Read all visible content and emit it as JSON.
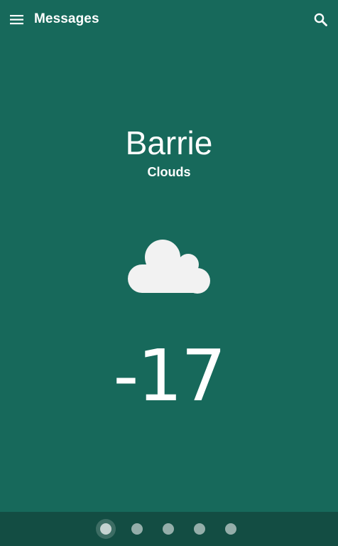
{
  "toolbar": {
    "title": "Messages",
    "menu_icon": "menu-icon",
    "search_icon": "search-icon"
  },
  "weather": {
    "city": "Barrie",
    "condition": "Clouds",
    "icon": "cloud-icon",
    "temperature": "-17"
  },
  "pager": {
    "page_count": 5,
    "active_page": 1
  },
  "colors": {
    "background": "#17695b",
    "bottom_bar": "#134d43",
    "text": "#ffffff",
    "cloud": "#f2f2f2"
  }
}
